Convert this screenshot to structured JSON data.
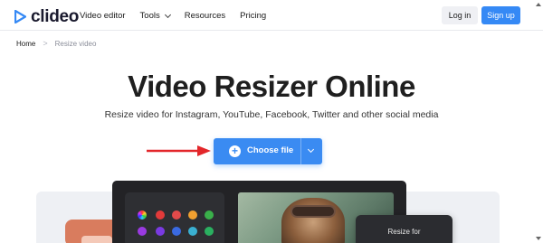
{
  "header": {
    "logo_text": "clideo",
    "brand_color": "#3589f5",
    "nav": [
      {
        "label": "Video editor",
        "has_dropdown": false
      },
      {
        "label": "Tools",
        "has_dropdown": true
      },
      {
        "label": "Resources",
        "has_dropdown": false
      },
      {
        "label": "Pricing",
        "has_dropdown": false
      }
    ],
    "login_label": "Log in",
    "signup_label": "Sign up"
  },
  "breadcrumb": {
    "home": "Home",
    "separator": ">",
    "current": "Resize video"
  },
  "hero": {
    "title": "Video Resizer Online",
    "subtitle": "Resize video for Instagram, YouTube, Facebook, Twitter and other social media",
    "choose_file_label": "Choose file",
    "choose_file_color": "#3a8bf2",
    "annotation_arrow_color": "#e3262a"
  },
  "preview": {
    "popup_label": "Resize for",
    "swatch_colors": [
      "#ffffff",
      "#e23a3a",
      "#e24a4a",
      "#f0a030",
      "#f0c030",
      "#3ab04a",
      "#9a3ae2",
      "#7a3ae2",
      "#3a6ae2",
      "#3ab0d2",
      "#3ac0a0",
      "#2ab060"
    ]
  }
}
